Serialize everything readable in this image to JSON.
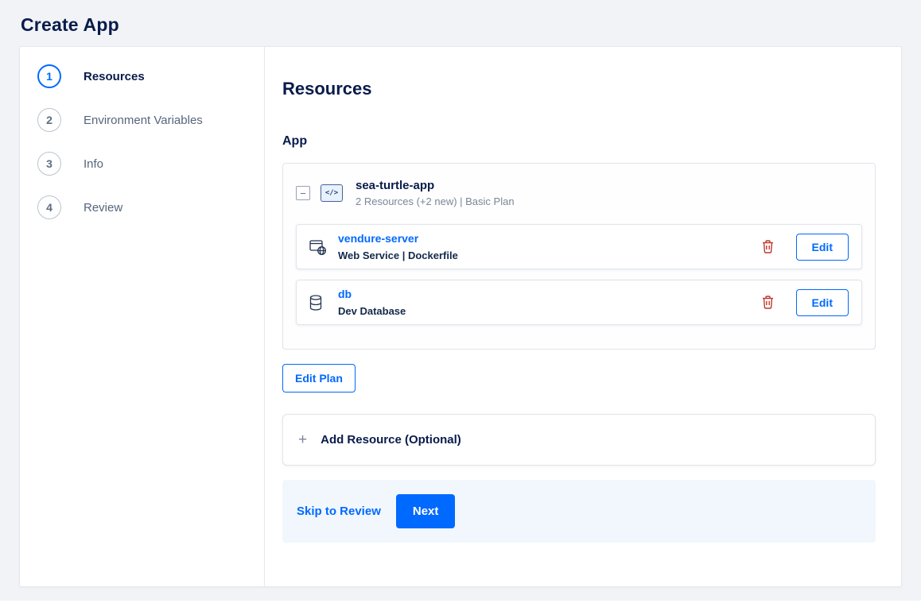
{
  "page": {
    "title": "Create App"
  },
  "stepper": {
    "steps": [
      {
        "number": "1",
        "label": "Resources"
      },
      {
        "number": "2",
        "label": "Environment Variables"
      },
      {
        "number": "3",
        "label": "Info"
      },
      {
        "number": "4",
        "label": "Review"
      }
    ]
  },
  "content": {
    "heading": "Resources",
    "section_label": "App",
    "app_card": {
      "collapse_glyph": "−",
      "app_icon_glyph": "</>",
      "name": "sea-turtle-app",
      "subtitle": "2 Resources (+2 new) | Basic Plan",
      "resources": [
        {
          "icon": "web-service-icon",
          "name": "vendure-server",
          "detail": "Web Service | Dockerfile",
          "edit_label": "Edit"
        },
        {
          "icon": "database-icon",
          "name": "db",
          "detail": "Dev Database",
          "edit_label": "Edit"
        }
      ]
    },
    "edit_plan_label": "Edit Plan",
    "add_resource": {
      "plus_glyph": "+",
      "label": "Add Resource (Optional)"
    },
    "footer": {
      "skip_label": "Skip to Review",
      "next_label": "Next"
    }
  },
  "colors": {
    "accent": "#0069ff",
    "danger": "#c0392b",
    "heading": "#081b4b"
  }
}
